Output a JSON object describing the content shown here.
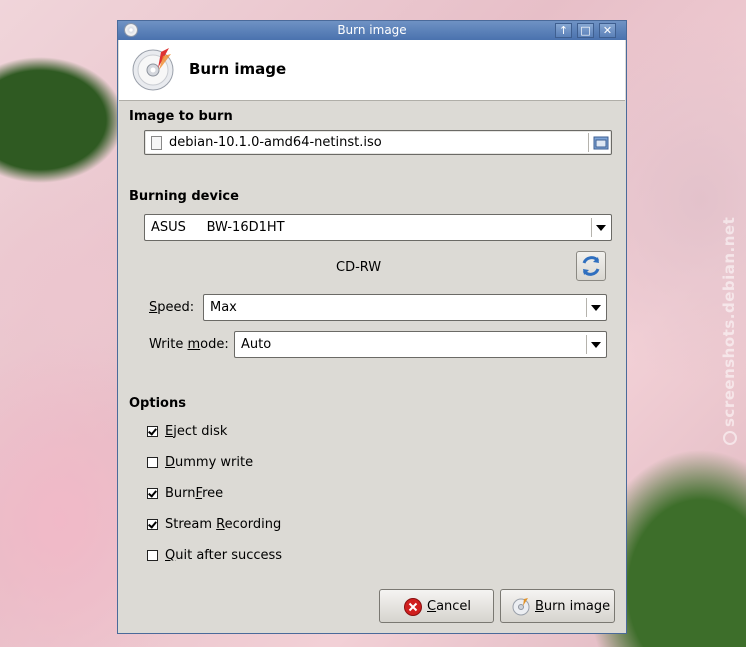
{
  "window": {
    "title": "Burn image",
    "header_title": "Burn image"
  },
  "image_section": {
    "label": "Image to burn",
    "file_name": "debian-10.1.0-amd64-netinst.iso"
  },
  "device_section": {
    "label": "Burning device",
    "device": "ASUS     BW-16D1HT",
    "media_type": "CD-RW",
    "speed_label_pre": "",
    "speed_label_u": "S",
    "speed_label_post": "peed:",
    "speed_value": "Max",
    "writemode_label_pre": "Write ",
    "writemode_label_u": "m",
    "writemode_label_post": "ode:",
    "writemode_value": "Auto"
  },
  "options_section": {
    "label": "Options",
    "items": [
      {
        "pre": "",
        "u": "E",
        "post": "ject disk",
        "checked": true
      },
      {
        "pre": "",
        "u": "D",
        "post": "ummy write",
        "checked": false
      },
      {
        "pre": "Burn",
        "u": "F",
        "post": "ree",
        "checked": true
      },
      {
        "pre": "Stream ",
        "u": "R",
        "post": "ecording",
        "checked": true
      },
      {
        "pre": "",
        "u": "Q",
        "post": "uit after success",
        "checked": false
      }
    ]
  },
  "buttons": {
    "cancel_u": "C",
    "cancel_post": "ancel",
    "burn_u": "B",
    "burn_post": "urn image"
  },
  "watermark": "screenshots.debian.net"
}
